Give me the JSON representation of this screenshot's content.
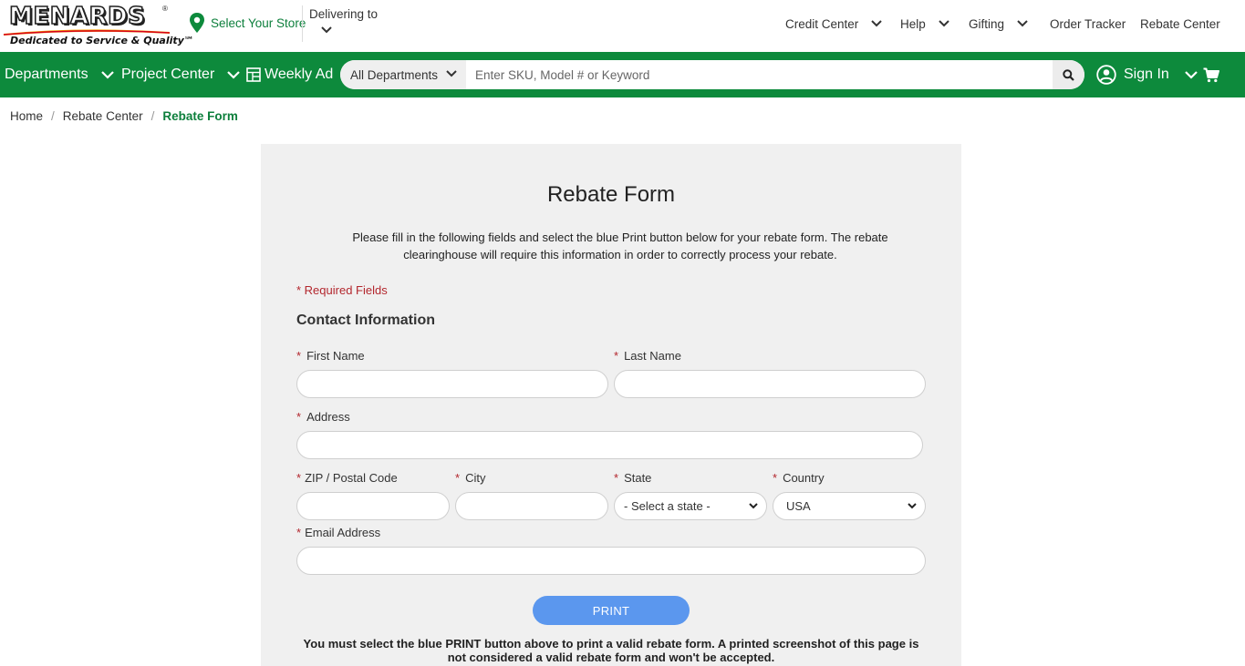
{
  "brand": {
    "logo_text": "MENARDS",
    "logo_reg": "®",
    "tagline": "Dedicated to Service & Quality℠",
    "green": "#0d8a3c",
    "button_blue": "#5b97ee",
    "required_red": "#b3272e"
  },
  "header": {
    "store_link": "Select Your Store",
    "delivering_label": "Delivering to",
    "utility_nav": [
      {
        "label": "Credit Center",
        "has_dropdown": true
      },
      {
        "label": "Help",
        "has_dropdown": true
      },
      {
        "label": "Gifting",
        "has_dropdown": true
      },
      {
        "label": "Order Tracker",
        "has_dropdown": false
      },
      {
        "label": "Rebate Center",
        "has_dropdown": false
      }
    ]
  },
  "nav": {
    "departments": "Departments",
    "project_center": "Project Center",
    "weekly_ad": "Weekly Ad",
    "search_scope": "All Departments",
    "search_placeholder": "Enter SKU, Model # or Keyword",
    "sign_in": "Sign In"
  },
  "breadcrumb": {
    "items": [
      "Home",
      "Rebate Center"
    ],
    "current": "Rebate Form",
    "separator": "/"
  },
  "form": {
    "title": "Rebate Form",
    "intro": "Please fill in the following fields and select the blue Print button below for your rebate form. The rebate clearinghouse will require this information in order to correctly process your rebate.",
    "required_note": "* Required Fields",
    "section_title": "Contact Information",
    "required_marker": "*",
    "fields": {
      "first_name": {
        "label": "First Name",
        "value": ""
      },
      "last_name": {
        "label": "Last Name",
        "value": ""
      },
      "address": {
        "label": "Address",
        "value": ""
      },
      "zip": {
        "label": "ZIP / Postal Code",
        "value": ""
      },
      "city": {
        "label": "City",
        "value": ""
      },
      "state": {
        "label": "State",
        "value": "- Select a state -"
      },
      "country": {
        "label": "Country",
        "value": "USA"
      },
      "email": {
        "label": "Email Address",
        "value": ""
      }
    },
    "print_button": "PRINT",
    "warning": "You must select the blue PRINT button above to print a valid rebate form. A printed screenshot of this page is not considered a valid rebate form and won't be accepted."
  }
}
